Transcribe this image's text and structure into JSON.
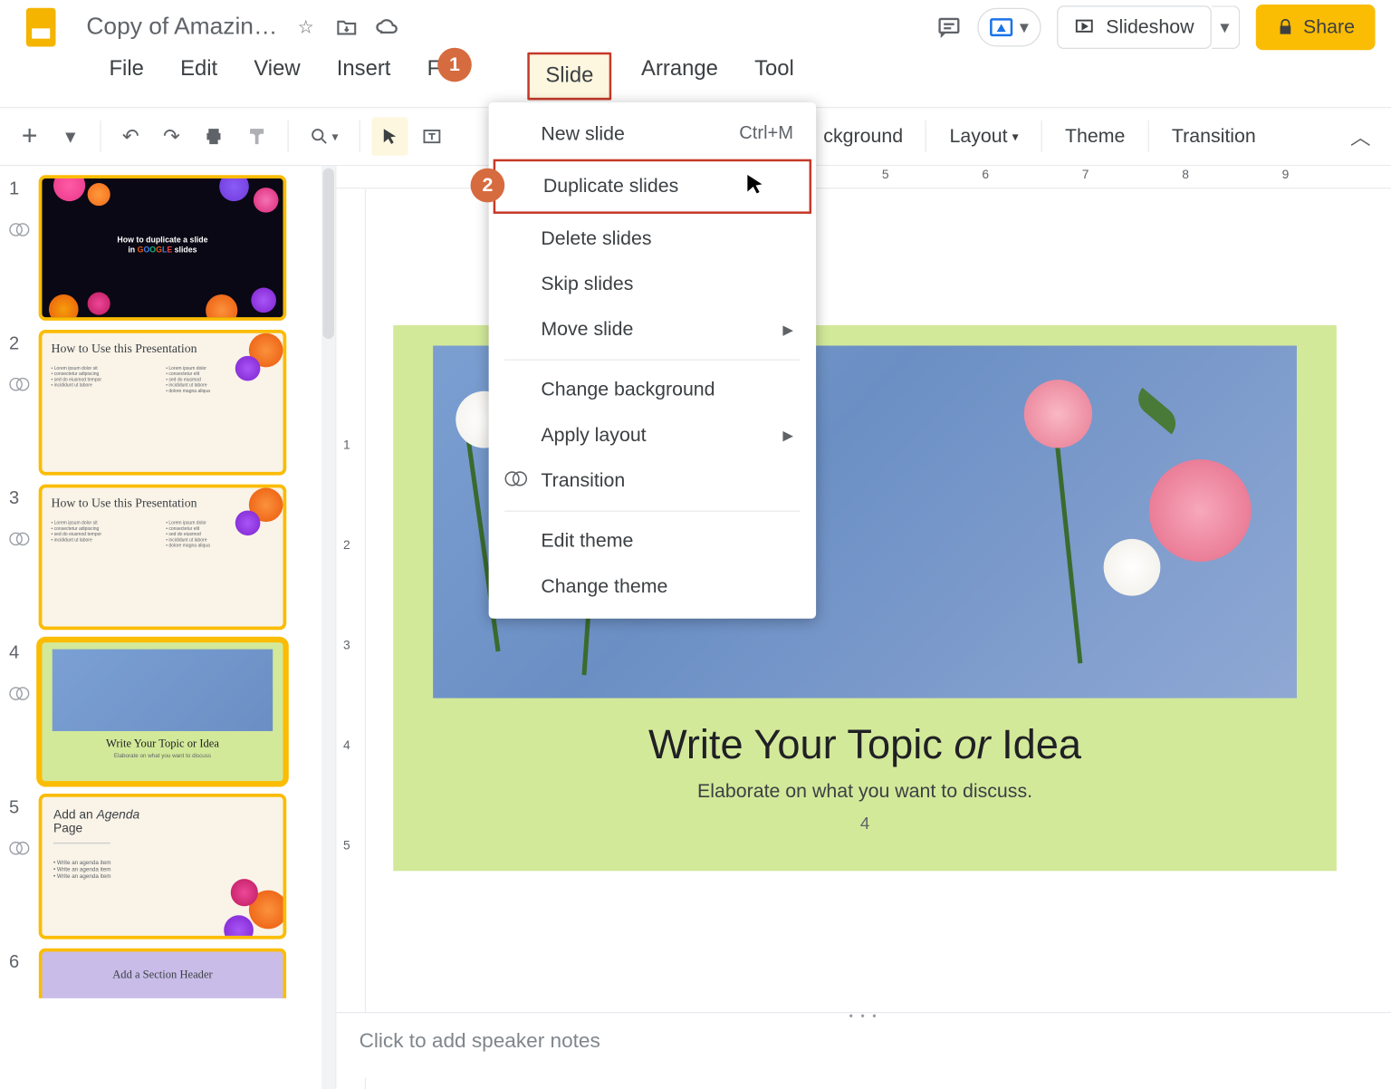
{
  "title": "Copy of Amazin…",
  "menus": [
    "File",
    "Edit",
    "View",
    "Insert",
    "Fo",
    "Slide",
    "Arrange",
    "Tool"
  ],
  "toolbar": {
    "background": "ckground",
    "layout": "Layout",
    "theme": "Theme",
    "transition": "Transition"
  },
  "slideshow_label": "Slideshow",
  "share_label": "Share",
  "badges": {
    "one": "1",
    "two": "2"
  },
  "dropdown": {
    "new_slide": "New slide",
    "new_slide_shortcut": "Ctrl+M",
    "duplicate": "Duplicate slides",
    "delete": "Delete slides",
    "skip": "Skip slides",
    "move": "Move slide",
    "change_bg": "Change background",
    "apply_layout": "Apply layout",
    "transition": "Transition",
    "edit_theme": "Edit theme",
    "change_theme": "Change theme"
  },
  "ruler_h": [
    "5",
    "6",
    "7",
    "8",
    "9"
  ],
  "ruler_v": [
    "1",
    "2",
    "3",
    "4",
    "5"
  ],
  "canvas": {
    "title_pre": "Write Your Topic ",
    "title_em": "or",
    "title_post": " Idea",
    "sub": "Elaborate on what you want to discuss.",
    "page": "4"
  },
  "notes_placeholder": "Click to add speaker notes",
  "thumbs": {
    "t1_line1": "How to duplicate a slide",
    "t1_line2_pre": "in ",
    "t1_line2_post": " slides",
    "t2_title": "How to Use this Presentation",
    "t4_title": "Write Your Topic or Idea",
    "t4_sub": "Elaborate on what you want to discuss",
    "t5_title": "Add an Agenda Page",
    "t5_item": "Write an agenda item",
    "t6_title": "Add a Section Header"
  },
  "slide_numbers": [
    "1",
    "2",
    "3",
    "4",
    "5",
    "6"
  ]
}
